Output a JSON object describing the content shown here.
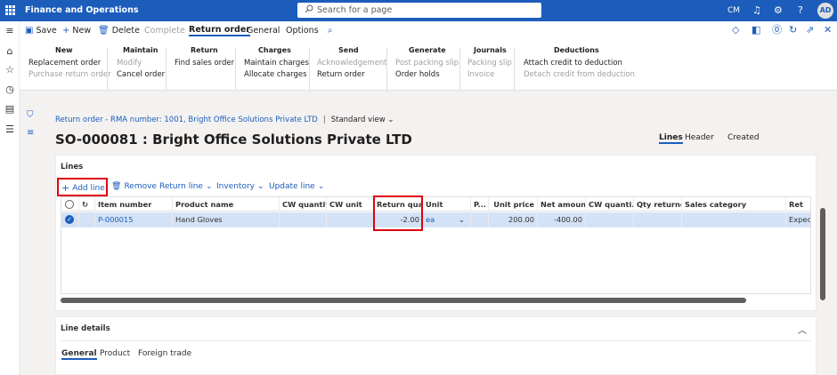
{
  "topbar": {
    "app_name": "Finance and Operations",
    "search_placeholder": "Search for a page",
    "company": "CM",
    "user_initials": "AD"
  },
  "actionbar": {
    "save": "Save",
    "new": "New",
    "delete": "Delete",
    "complete": "Complete",
    "tabs": [
      "Return order",
      "General",
      "Options"
    ]
  },
  "groups": {
    "new": {
      "title": "New",
      "items": [
        "Replacement order",
        "Purchase return order"
      ]
    },
    "maintain": {
      "title": "Maintain",
      "items": [
        "Modify",
        "Cancel order"
      ]
    },
    "return": {
      "title": "Return",
      "items": [
        "Find sales order"
      ]
    },
    "charges": {
      "title": "Charges",
      "items": [
        "Maintain charges",
        "Allocate charges"
      ]
    },
    "send": {
      "title": "Send",
      "items": [
        "Acknowledgement",
        "Return order"
      ]
    },
    "generate": {
      "title": "Generate",
      "items": [
        "Post packing slip",
        "Order holds"
      ]
    },
    "journals": {
      "title": "Journals",
      "items": [
        "Packing slip",
        "Invoice"
      ]
    },
    "deductions": {
      "title": "Deductions",
      "items": [
        "Attach credit to deduction",
        "Detach credit from deduction"
      ]
    }
  },
  "page": {
    "breadcrumb": "Return order - RMA number: 1001, Bright Office Solutions Private LTD",
    "view": "Standard view",
    "title": "SO-000081 : Bright Office Solutions Private LTD",
    "view_tabs": [
      "Lines",
      "Header",
      "Created"
    ]
  },
  "lines": {
    "title": "Lines",
    "toolbar": {
      "add_line": "Add line",
      "remove": "Remove",
      "return_line": "Return line",
      "inventory": "Inventory",
      "update_line": "Update line"
    },
    "columns": [
      "Item number",
      "Product name",
      "CW quantity",
      "CW unit",
      "Return qua...",
      "Unit",
      "P...",
      "Unit price",
      "Net amount",
      "CW quanti...",
      "Qty returned",
      "Sales category",
      "Ret"
    ],
    "rows": [
      {
        "item_number": "P-000015",
        "product_name": "Hand Gloves",
        "cw_quantity": "",
        "cw_unit": "",
        "return_quantity": "-2.00",
        "unit": "ea",
        "p": "",
        "unit_price": "200.00",
        "net_amount": "-400.00",
        "cw_quantity2": "",
        "qty_returned": "",
        "sales_category": "",
        "ret": "Expect"
      }
    ]
  },
  "line_details": {
    "title": "Line details",
    "tabs": [
      "General",
      "Product",
      "Foreign trade"
    ]
  },
  "colors": {
    "brand": "#1c5dbc",
    "highlight": "#e00010",
    "selected_row": "#d3e2f6"
  }
}
